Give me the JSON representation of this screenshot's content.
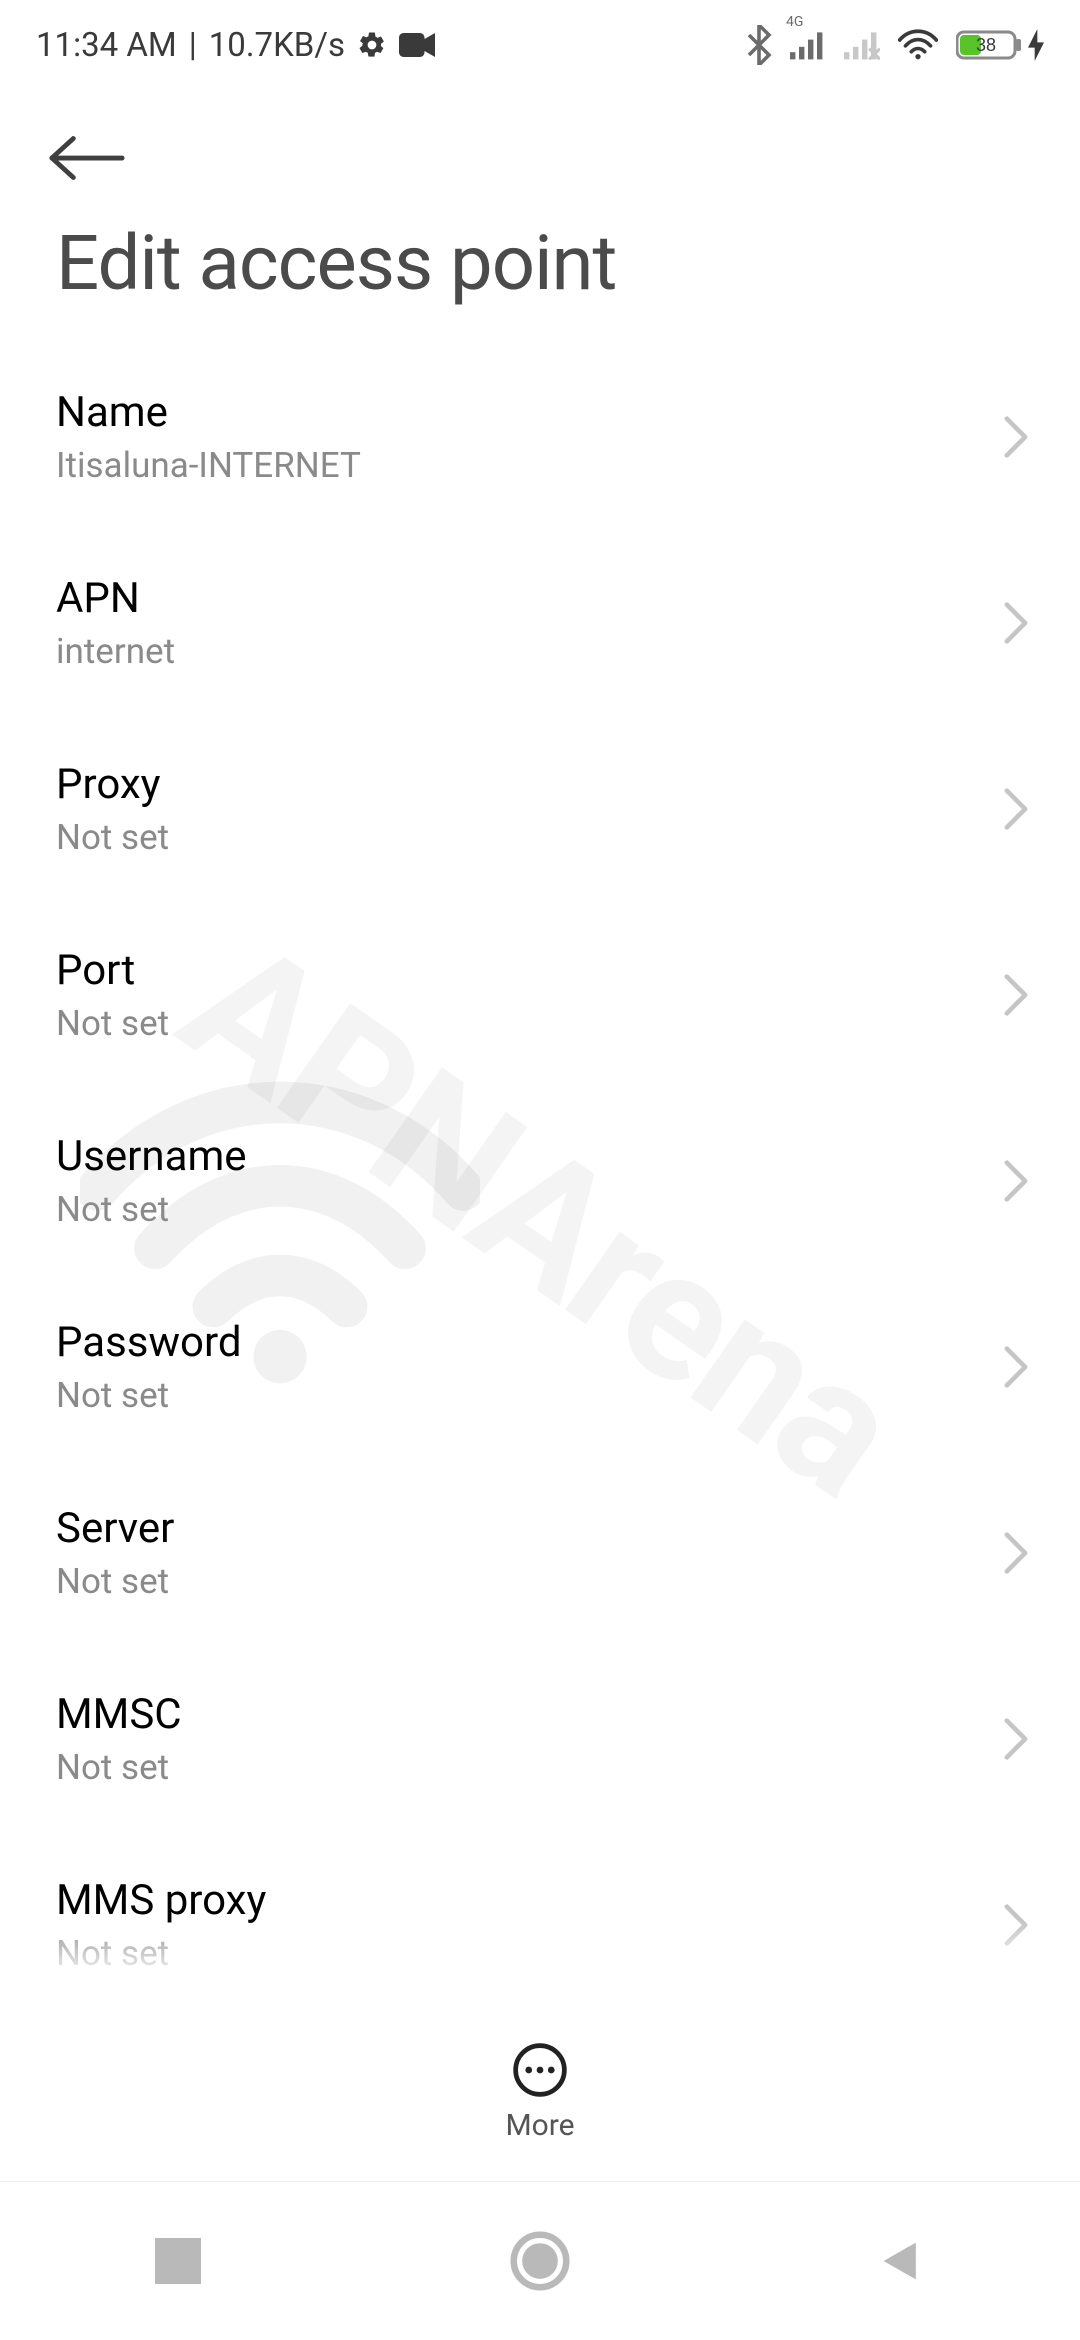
{
  "status": {
    "time": "11:34 AM",
    "sep": " | ",
    "rate": "10.7KB/s",
    "battery_pct": "38"
  },
  "header": {
    "title": "Edit access point"
  },
  "items": [
    {
      "label": "Name",
      "value": "Itisaluna-INTERNET"
    },
    {
      "label": "APN",
      "value": "internet"
    },
    {
      "label": "Proxy",
      "value": "Not set"
    },
    {
      "label": "Port",
      "value": "Not set"
    },
    {
      "label": "Username",
      "value": "Not set"
    },
    {
      "label": "Password",
      "value": "Not set"
    },
    {
      "label": "Server",
      "value": "Not set"
    },
    {
      "label": "MMSC",
      "value": "Not set"
    },
    {
      "label": "MMS proxy",
      "value": "Not set"
    }
  ],
  "more": {
    "label": "More"
  },
  "watermark": "APNArena"
}
